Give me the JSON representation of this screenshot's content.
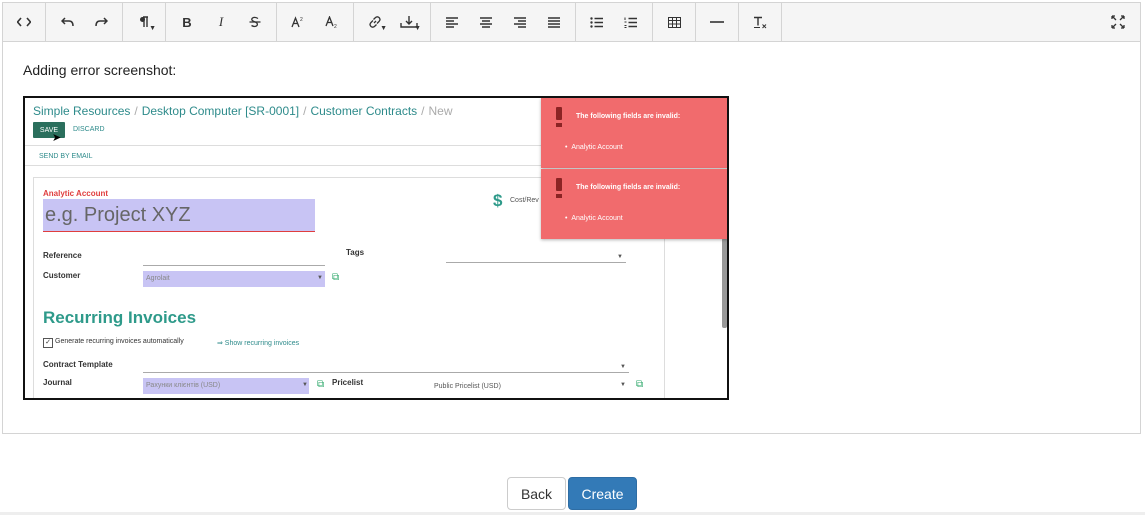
{
  "toolbar": {
    "icons": [
      "code-view-icon",
      "undo-icon",
      "redo-icon",
      "paragraph-icon",
      "bold-icon",
      "italic-icon",
      "strikethrough-icon",
      "superscript-icon",
      "subscript-icon",
      "link-icon",
      "insert-icon",
      "align-left-icon",
      "align-center-icon",
      "align-right-icon",
      "align-justify-icon",
      "bullet-list-icon",
      "numbered-list-icon",
      "table-icon",
      "horizontal-rule-icon",
      "clear-format-icon",
      "fullscreen-icon"
    ],
    "bold": "B",
    "italic": "I"
  },
  "body_text": "Adding error screenshot:",
  "screenshot": {
    "breadcrumb": [
      "Simple Resources",
      "Desktop Computer [SR-0001]",
      "Customer Contracts",
      "New"
    ],
    "save": "SAVE",
    "discard": "DISCARD",
    "send_by_email": "SEND BY EMAIL",
    "analytic_account_label": "Analytic Account",
    "analytic_account_placeholder": "e.g. Project XYZ",
    "cost_label": "Cost/Rev",
    "reference_label": "Reference",
    "tags_label": "Tags",
    "customer_label": "Customer",
    "customer_value": "Agrolait",
    "recurring_title": "Recurring Invoices",
    "generate_label": "Generate recurring invoices automatically",
    "show_recurring": "⇒ Show recurring invoices",
    "contract_template_label": "Contract Template",
    "journal_label": "Journal",
    "journal_value": "Рахунки клієнтів (USD)",
    "pricelist_label": "Pricelist",
    "pricelist_value": "Public Pricelist (USD)",
    "errors": [
      {
        "title": "The following fields are invalid:",
        "item": "Analytic Account"
      },
      {
        "title": "The following fields are invalid:",
        "item": "Analytic Account"
      }
    ]
  },
  "buttons": {
    "back": "Back",
    "create": "Create"
  },
  "colors": {
    "primary": "#337ab7",
    "error": "#f16b6d",
    "odoo_teal": "#2e9a8a",
    "invalid_field": "#c8c4f4"
  }
}
